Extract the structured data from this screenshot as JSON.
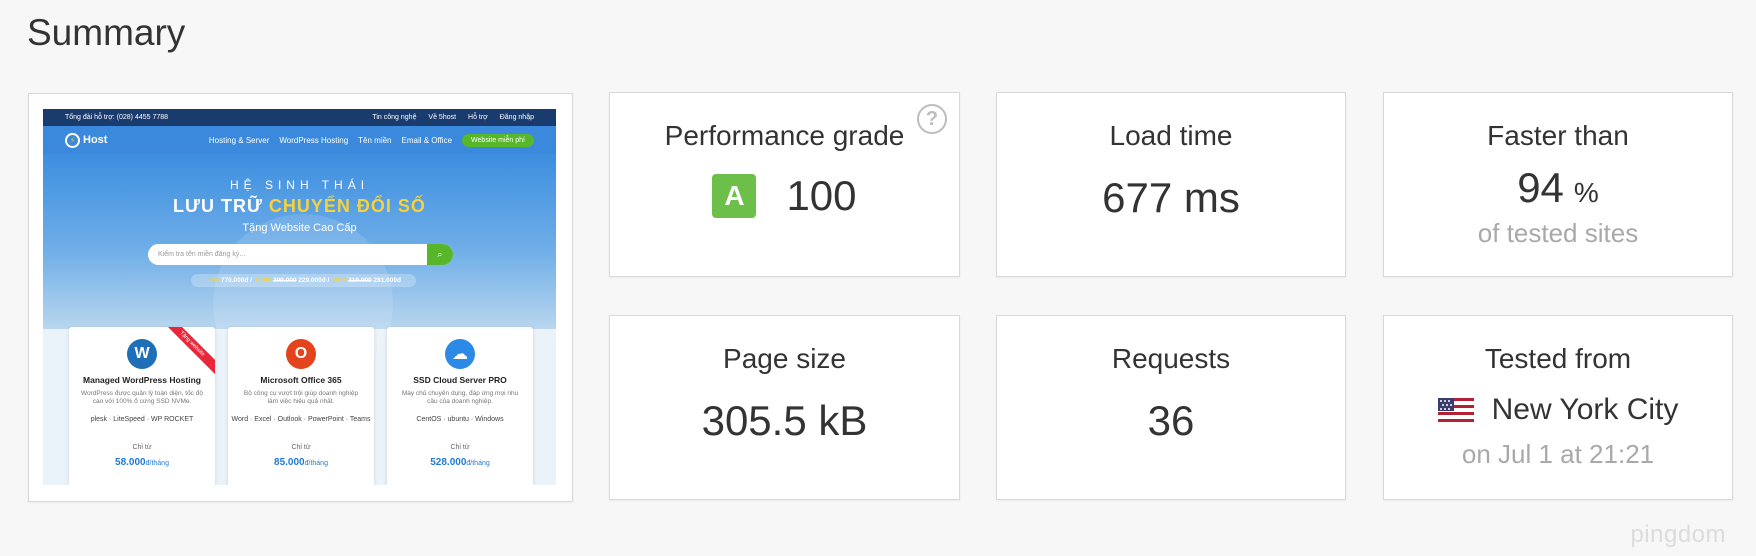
{
  "page": {
    "title": "Summary",
    "watermark": "pingdom"
  },
  "screenshot_preview": {
    "topbar": {
      "hotline": "Tổng đài hỗ trợ: (028) 4455 7788",
      "links": [
        "Tin công nghệ",
        "Về 5host",
        "Hỗ trợ",
        "Đăng nhập"
      ]
    },
    "nav": {
      "logo": "Host",
      "menu": [
        "Hosting & Server",
        "WordPress Hosting",
        "Tên miền",
        "Email & Office"
      ],
      "cta": "Website miễn phí"
    },
    "hero": {
      "eyebrow": "HỆ SINH THÁI",
      "headline_a": "LƯU TRỮ ",
      "headline_b": "CHUYỂN ĐỔI SỐ",
      "subtitle": "Tặng Website Cao Cấp",
      "search_placeholder": "Kiểm tra tên miền đăng ký...",
      "prices": [
        {
          "tld": ".VN",
          "price": "770.000đ"
        },
        {
          "tld": ".COM",
          "old": "399.000",
          "price": "229.000đ"
        },
        {
          "tld": ".NET",
          "old": "319.000",
          "price": "281.000đ"
        }
      ]
    },
    "plans": [
      {
        "name": "Managed WordPress Hosting",
        "desc": "WordPress được quản lý toàn diện, tốc độ cao với 100% ổ cứng SSD NVMe.",
        "brands": "plesk · LiteSpeed · WP ROCKET",
        "from": "Chỉ từ",
        "price": "58.000",
        "unit": "đ/tháng",
        "ribbon": "Tặng website",
        "icon_color": "#1e6fb8",
        "icon_glyph": "W"
      },
      {
        "name": "Microsoft Office 365",
        "desc": "Bộ công cụ vượt trội giúp doanh nghiệp làm việc hiệu quả nhất.",
        "brands": "Word · Excel · Outlook · PowerPoint · Teams",
        "from": "Chỉ từ",
        "price": "85.000",
        "unit": "đ/tháng",
        "icon_color": "#e3441d",
        "icon_glyph": "O"
      },
      {
        "name": "SSD Cloud Server PRO",
        "desc": "Máy chủ chuyên dụng, đáp ứng mọi nhu cầu của doanh nghiệp.",
        "brands": "CentOS · ubuntu · Windows",
        "from": "Chỉ từ",
        "price": "528.000",
        "unit": "đ/tháng",
        "icon_color": "#2b8ae6",
        "icon_glyph": "☁"
      }
    ]
  },
  "metrics": {
    "performance": {
      "label": "Performance grade",
      "grade": "A",
      "score": "100",
      "help": "?"
    },
    "load_time": {
      "label": "Load time",
      "value": "677 ms"
    },
    "faster_than": {
      "label": "Faster than",
      "value": "94",
      "unit": "%",
      "note": "of tested sites"
    },
    "page_size": {
      "label": "Page size",
      "value": "305.5 kB"
    },
    "requests": {
      "label": "Requests",
      "value": "36"
    },
    "tested_from": {
      "label": "Tested from",
      "city": "New York City",
      "date": "on Jul 1 at 21:21",
      "flag": "us-flag-icon"
    }
  },
  "colors": {
    "grade_green": "#6cc04a",
    "flag_red": "#b22234",
    "flag_blue": "#3c3b6e"
  }
}
